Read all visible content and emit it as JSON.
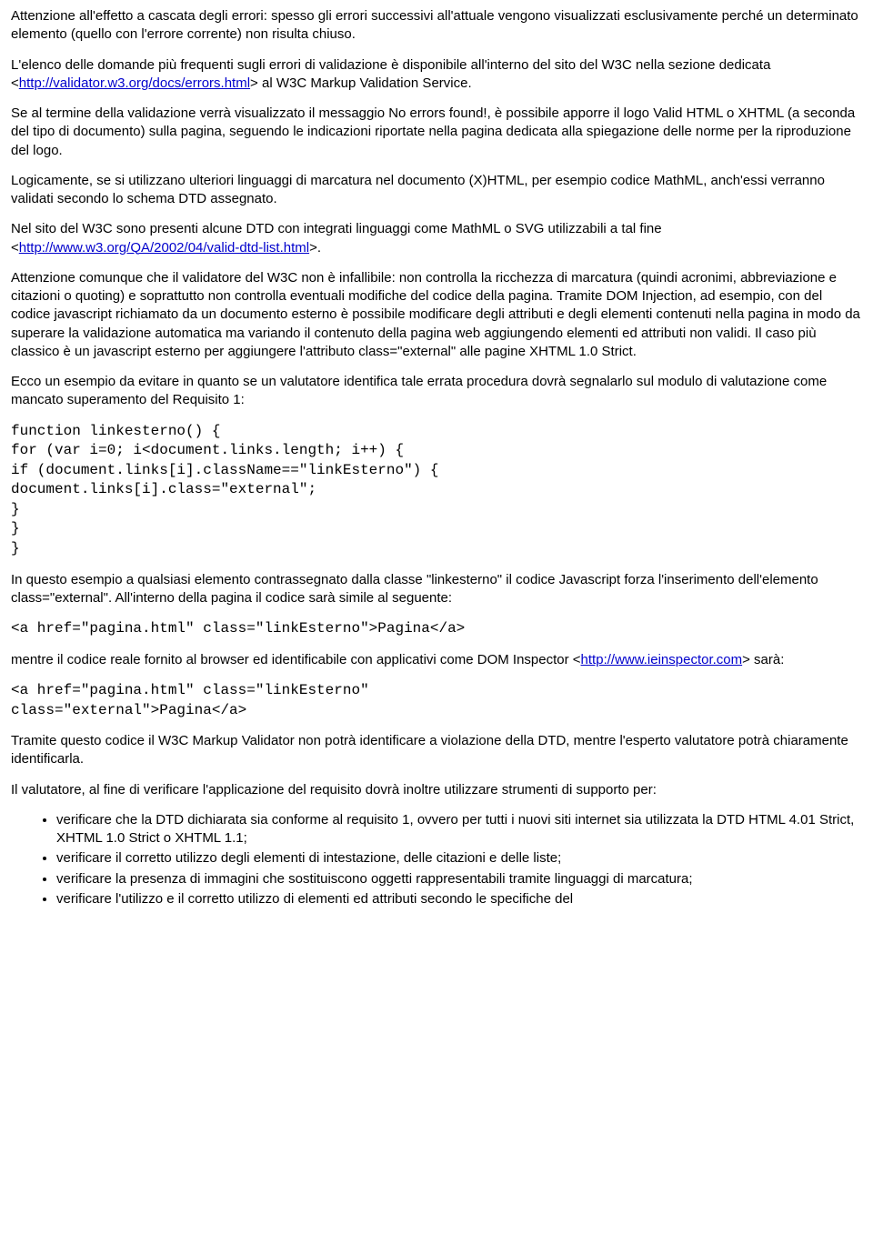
{
  "p1_a": "Attenzione all'effetto a cascata degli errori: spesso gli errori successivi all'attuale vengono visualizzati esclusivamente perché un determinato elemento (quello con l'errore corrente) non risulta chiuso.",
  "p2_a": "L'elenco delle domande più frequenti sugli errori di validazione è disponibile all'interno del sito del W3C nella sezione dedicata <",
  "p2_link": "http://validator.w3.org/docs/errors.html",
  "p2_b": "> al W3C Markup Validation Service.",
  "p3_a": "Se al termine della validazione verrà visualizzato il messaggio No errors found!, è possibile apporre il logo Valid HTML o XHTML (a seconda del tipo di documento) sulla pagina, seguendo le indicazioni riportate nella pagina dedicata alla spiegazione delle norme per la riproduzione del logo.",
  "p4_a": "Logicamente, se si utilizzano ulteriori linguaggi di marcatura nel documento (X)HTML, per esempio codice MathML, anch'essi verranno validati secondo lo schema DTD assegnato.",
  "p5_a": "Nel sito del W3C sono presenti alcune DTD con integrati linguaggi come MathML o SVG utilizzabili a tal fine <",
  "p5_link": "http://www.w3.org/QA/2002/04/valid-dtd-list.html",
  "p5_b": ">.",
  "p6_a": "Attenzione comunque che il validatore del W3C non è infallibile: non controlla la ricchezza di marcatura (quindi acronimi, abbreviazione e citazioni o quoting) e soprattutto non controlla eventuali modifiche del codice della pagina. Tramite DOM Injection, ad esempio, con del codice javascript richiamato da un documento esterno è possibile modificare degli attributi e degli elementi contenuti nella pagina in modo da superare la validazione automatica ma variando il contenuto della pagina web aggiungendo elementi ed attributi non validi. Il caso più classico è un javascript esterno per aggiungere l'attributo class=\"external\" alle pagine XHTML 1.0 Strict.",
  "p7_a": "Ecco un esempio da evitare in quanto se un valutatore identifica tale errata procedura dovrà segnalarlo sul modulo di valutazione come mancato superamento del Requisito 1:",
  "code1": "function linkesterno() {\nfor (var i=0; i<document.links.length; i++) {\nif (document.links[i].className==\"linkEsterno\") {\ndocument.links[i].class=\"external\";\n}\n}\n}",
  "p8_a": "In questo esempio a qualsiasi elemento contrassegnato dalla classe \"linkesterno\" il codice Javascript forza l'inserimento dell'elemento class=\"external\". All'interno della pagina il codice sarà simile al seguente:",
  "code2": "<a href=\"pagina.html\" class=\"linkEsterno\">Pagina</a>",
  "p9_a": "mentre il codice reale fornito al browser ed identificabile con applicativi come DOM Inspector <",
  "p9_link": "http://www.ieinspector.com",
  "p9_b": "> sarà:",
  "code3": "<a href=\"pagina.html\" class=\"linkEsterno\"\nclass=\"external\">Pagina</a>",
  "p10_a": "Tramite questo codice il W3C Markup Validator non potrà identificare a violazione della DTD, mentre l'esperto valutatore potrà chiaramente identificarla.",
  "p11_a": "Il valutatore, al fine di verificare l'applicazione del requisito dovrà inoltre utilizzare strumenti di supporto per:",
  "li1": "verificare che la DTD dichiarata sia conforme al requisito 1, ovvero per tutti i nuovi siti internet sia utilizzata la DTD HTML 4.01 Strict, XHTML 1.0 Strict o XHTML 1.1;",
  "li2": "verificare il corretto utilizzo degli elementi di intestazione, delle citazioni e delle liste;",
  "li3": "verificare la presenza di immagini che sostituiscono oggetti rappresentabili tramite linguaggi di marcatura;",
  "li4": "verificare l'utilizzo e il corretto utilizzo di elementi ed attributi secondo le specifiche del"
}
